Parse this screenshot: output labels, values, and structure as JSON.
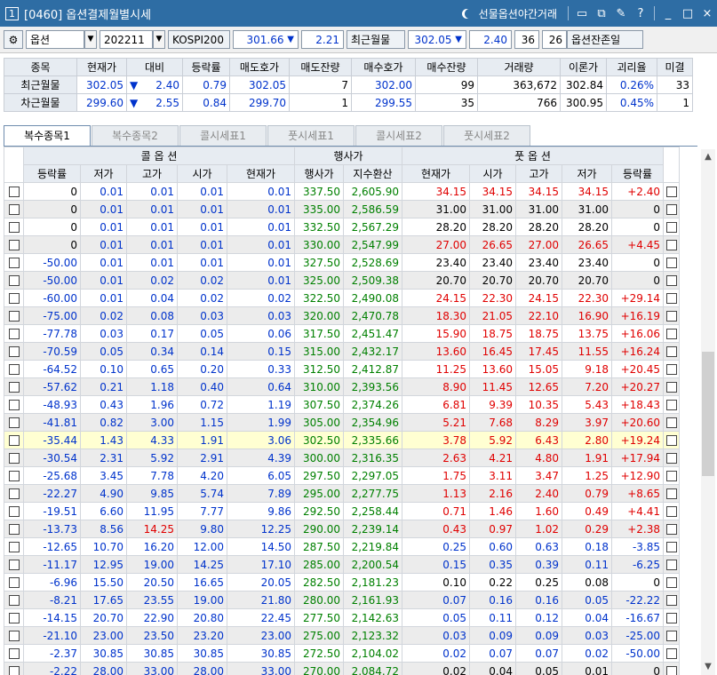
{
  "window": {
    "num": "1",
    "title": "[0460] 옵션결제월별시세",
    "night_label": "선물옵션야간거래",
    "btns": [
      "▭",
      "⧉",
      "✎",
      "?",
      "_",
      "□",
      "×"
    ]
  },
  "toolbar": {
    "type": "옵션",
    "month": "202211",
    "index_name": "KOSPI200",
    "index_value": "301.66",
    "index_arrow": "▼",
    "index_change": "2.21",
    "near_label": "최근월물",
    "near_value": "302.05",
    "near_arrow": "▼",
    "near_change": "2.40",
    "count": "36",
    "days": "26",
    "remain_label": "옵션잔존일"
  },
  "summary": {
    "headers": [
      "종목",
      "현재가",
      "대비",
      "등락률",
      "매도호가",
      "매도잔량",
      "매수호가",
      "매수잔량",
      "거래량",
      "이론가",
      "괴리율",
      "미결"
    ],
    "rows": [
      [
        "최근월물",
        "302.05",
        "▼",
        "2.40",
        "0.79",
        "302.05",
        "7",
        "302.00",
        "99",
        "363,672",
        "302.84",
        "0.26%",
        "33"
      ],
      [
        "차근월물",
        "299.60",
        "▼",
        "2.55",
        "0.84",
        "299.70",
        "1",
        "299.55",
        "35",
        "766",
        "300.95",
        "0.45%",
        "1"
      ]
    ]
  },
  "tabs": [
    "복수종목1",
    "복수종목2",
    "콜시세표1",
    "풋시세표1",
    "콜시세표2",
    "풋시세표2"
  ],
  "grid": {
    "call_label": "콜   옵   션",
    "strike_label": "행사가",
    "put_label": "풋   옵   션",
    "headers": [
      "등락률",
      "저가",
      "고가",
      "시가",
      "현재가",
      "행사가",
      "지수환산",
      "현재가",
      "시가",
      "고가",
      "저가",
      "등락률"
    ],
    "rows": [
      [
        "0",
        "0.01",
        "0.01",
        "0.01",
        "0.01",
        "337.50",
        "2,605.90",
        "34.15",
        "34.15",
        "34.15",
        "34.15",
        "+2.40"
      ],
      [
        "0",
        "0.01",
        "0.01",
        "0.01",
        "0.01",
        "335.00",
        "2,586.59",
        "31.00",
        "31.00",
        "31.00",
        "31.00",
        "0"
      ],
      [
        "0",
        "0.01",
        "0.01",
        "0.01",
        "0.01",
        "332.50",
        "2,567.29",
        "28.20",
        "28.20",
        "28.20",
        "28.20",
        "0"
      ],
      [
        "0",
        "0.01",
        "0.01",
        "0.01",
        "0.01",
        "330.00",
        "2,547.99",
        "27.00",
        "26.65",
        "27.00",
        "26.65",
        "+4.45"
      ],
      [
        "-50.00",
        "0.01",
        "0.01",
        "0.01",
        "0.01",
        "327.50",
        "2,528.69",
        "23.40",
        "23.40",
        "23.40",
        "23.40",
        "0"
      ],
      [
        "-50.00",
        "0.01",
        "0.02",
        "0.02",
        "0.01",
        "325.00",
        "2,509.38",
        "20.70",
        "20.70",
        "20.70",
        "20.70",
        "0"
      ],
      [
        "-60.00",
        "0.01",
        "0.04",
        "0.02",
        "0.02",
        "322.50",
        "2,490.08",
        "24.15",
        "22.30",
        "24.15",
        "22.30",
        "+29.14"
      ],
      [
        "-75.00",
        "0.02",
        "0.08",
        "0.03",
        "0.03",
        "320.00",
        "2,470.78",
        "18.30",
        "21.05",
        "22.10",
        "16.90",
        "+16.19"
      ],
      [
        "-77.78",
        "0.03",
        "0.17",
        "0.05",
        "0.06",
        "317.50",
        "2,451.47",
        "15.90",
        "18.75",
        "18.75",
        "13.75",
        "+16.06"
      ],
      [
        "-70.59",
        "0.05",
        "0.34",
        "0.14",
        "0.15",
        "315.00",
        "2,432.17",
        "13.60",
        "16.45",
        "17.45",
        "11.55",
        "+16.24"
      ],
      [
        "-64.52",
        "0.10",
        "0.65",
        "0.20",
        "0.33",
        "312.50",
        "2,412.87",
        "11.25",
        "13.60",
        "15.05",
        "9.18",
        "+20.45"
      ],
      [
        "-57.62",
        "0.21",
        "1.18",
        "0.40",
        "0.64",
        "310.00",
        "2,393.56",
        "8.90",
        "11.45",
        "12.65",
        "7.20",
        "+20.27"
      ],
      [
        "-48.93",
        "0.43",
        "1.96",
        "0.72",
        "1.19",
        "307.50",
        "2,374.26",
        "6.81",
        "9.39",
        "10.35",
        "5.43",
        "+18.43"
      ],
      [
        "-41.81",
        "0.82",
        "3.00",
        "1.15",
        "1.99",
        "305.00",
        "2,354.96",
        "5.21",
        "7.68",
        "8.29",
        "3.97",
        "+20.60"
      ],
      [
        "-35.44",
        "1.43",
        "4.33",
        "1.91",
        "3.06",
        "302.50",
        "2,335.66",
        "3.78",
        "5.92",
        "6.43",
        "2.80",
        "+19.24"
      ],
      [
        "-30.54",
        "2.31",
        "5.92",
        "2.91",
        "4.39",
        "300.00",
        "2,316.35",
        "2.63",
        "4.21",
        "4.80",
        "1.91",
        "+17.94"
      ],
      [
        "-25.68",
        "3.45",
        "7.78",
        "4.20",
        "6.05",
        "297.50",
        "2,297.05",
        "1.75",
        "3.11",
        "3.47",
        "1.25",
        "+12.90"
      ],
      [
        "-22.27",
        "4.90",
        "9.85",
        "5.74",
        "7.89",
        "295.00",
        "2,277.75",
        "1.13",
        "2.16",
        "2.40",
        "0.79",
        "+8.65"
      ],
      [
        "-19.51",
        "6.60",
        "11.95",
        "7.77",
        "9.86",
        "292.50",
        "2,258.44",
        "0.71",
        "1.46",
        "1.60",
        "0.49",
        "+4.41"
      ],
      [
        "-13.73",
        "8.56",
        "14.25",
        "9.80",
        "12.25",
        "290.00",
        "2,239.14",
        "0.43",
        "0.97",
        "1.02",
        "0.29",
        "+2.38"
      ],
      [
        "-12.65",
        "10.70",
        "16.20",
        "12.00",
        "14.50",
        "287.50",
        "2,219.84",
        "0.25",
        "0.60",
        "0.63",
        "0.18",
        "-3.85"
      ],
      [
        "-11.17",
        "12.95",
        "19.00",
        "14.25",
        "17.10",
        "285.00",
        "2,200.54",
        "0.15",
        "0.35",
        "0.39",
        "0.11",
        "-6.25"
      ],
      [
        "-6.96",
        "15.50",
        "20.50",
        "16.65",
        "20.05",
        "282.50",
        "2,181.23",
        "0.10",
        "0.22",
        "0.25",
        "0.08",
        "0"
      ],
      [
        "-8.21",
        "17.65",
        "23.55",
        "19.00",
        "21.80",
        "280.00",
        "2,161.93",
        "0.07",
        "0.16",
        "0.16",
        "0.05",
        "-22.22"
      ],
      [
        "-14.15",
        "20.70",
        "22.90",
        "20.80",
        "22.45",
        "277.50",
        "2,142.63",
        "0.05",
        "0.11",
        "0.12",
        "0.04",
        "-16.67"
      ],
      [
        "-21.10",
        "23.00",
        "23.50",
        "23.20",
        "23.00",
        "275.00",
        "2,123.32",
        "0.03",
        "0.09",
        "0.09",
        "0.03",
        "-25.00"
      ],
      [
        "-2.37",
        "30.85",
        "30.85",
        "30.85",
        "30.85",
        "272.50",
        "2,104.02",
        "0.02",
        "0.07",
        "0.07",
        "0.02",
        "-50.00"
      ],
      [
        "-2.22",
        "28.00",
        "33.00",
        "28.00",
        "33.00",
        "270.00",
        "2,084.72",
        "0.02",
        "0.04",
        "0.05",
        "0.01",
        "0"
      ]
    ],
    "highlight_strike": "302.50"
  },
  "colors": {
    "call": "#0033cc",
    "strike": "#008000",
    "put_up": "#e00000",
    "put_down": "#0033cc",
    "highlight_row": "#ffffd2"
  }
}
